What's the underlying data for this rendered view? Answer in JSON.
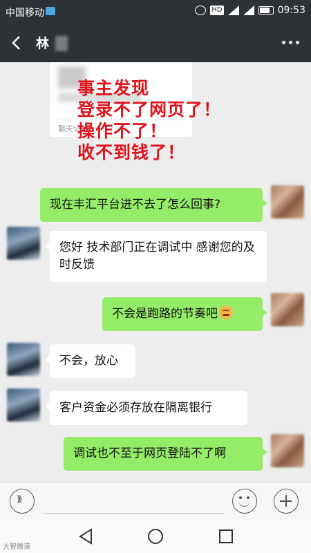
{
  "status_bar": {
    "carrier": "中国移动",
    "hd_badge": "HD",
    "time": "09:53"
  },
  "title_bar": {
    "contact_name": "林"
  },
  "quoted_card": {
    "label": "聊天记录"
  },
  "overlay": {
    "lines": [
      "事主发现",
      "登录不了网页了！",
      "操作不了！",
      "收不到钱了！"
    ],
    "color": "#e0121a"
  },
  "messages": [
    {
      "side": "right",
      "text": "现在丰汇平台进不去了怎么回事?"
    },
    {
      "side": "left",
      "text": "您好 技术部门正在调试中 感谢您的及时反馈"
    },
    {
      "side": "right",
      "text": "不会是跑路的节奏吧",
      "emoji": "worried-face"
    },
    {
      "side": "left",
      "text": "不会，放心"
    },
    {
      "side": "left",
      "text": "客户资金必须存放在隔离银行"
    },
    {
      "side": "right",
      "text": "调试也不至于网页登陆不了啊"
    }
  ],
  "colors": {
    "header_bg": "#2e3135",
    "chat_bg": "#ededed",
    "my_bubble": "#95ec69",
    "their_bubble": "#ffffff"
  },
  "watermark": "大智腾谟"
}
